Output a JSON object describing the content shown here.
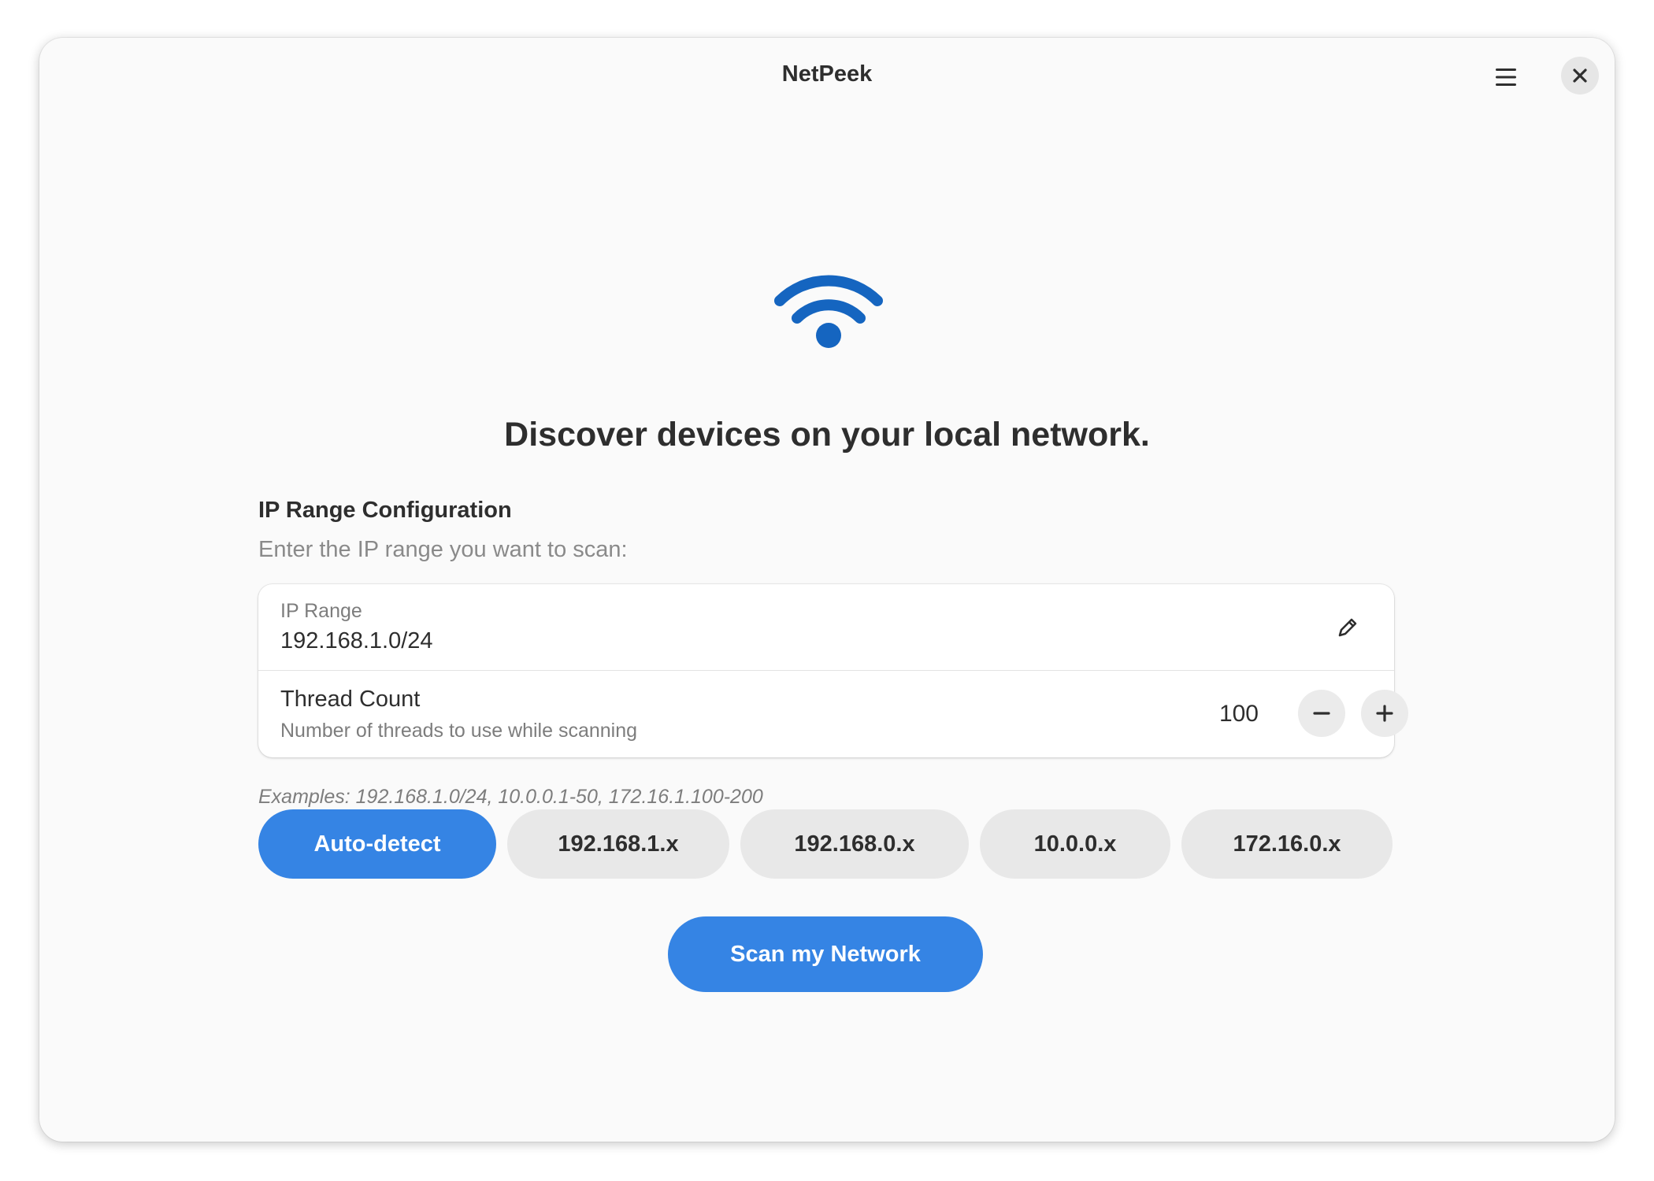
{
  "window": {
    "title": "NetPeek",
    "menu_icon": "hamburger-menu-icon",
    "close_icon": "close-icon"
  },
  "hero": {
    "icon": "wifi-icon",
    "headline": "Discover devices on your local network."
  },
  "config": {
    "section_title": "IP Range Configuration",
    "section_subtitle": "Enter the IP range you want to scan:",
    "ip_range": {
      "label": "IP Range",
      "value": "192.168.1.0/24",
      "edit_icon": "pencil-icon"
    },
    "thread_count": {
      "title": "Thread Count",
      "subtitle": "Number of threads to use while scanning",
      "value": "100",
      "decrement_icon": "minus-icon",
      "increment_icon": "plus-icon"
    },
    "examples": "Examples: 192.168.1.0/24, 10.0.0.1-50, 172.16.1.100-200"
  },
  "presets": [
    {
      "label": "Auto-detect",
      "active": true
    },
    {
      "label": "192.168.1.x",
      "active": false
    },
    {
      "label": "192.168.0.x",
      "active": false
    },
    {
      "label": "10.0.0.x",
      "active": false
    },
    {
      "label": "172.16.0.x",
      "active": false
    }
  ],
  "scan_button": "Scan my Network",
  "colors": {
    "accent": "#3584e4",
    "icon_blue": "#1565c0",
    "window_bg": "#fafafa",
    "card_bg": "#ffffff",
    "text": "#2e2e2e",
    "muted_text": "#7d7d7d"
  }
}
